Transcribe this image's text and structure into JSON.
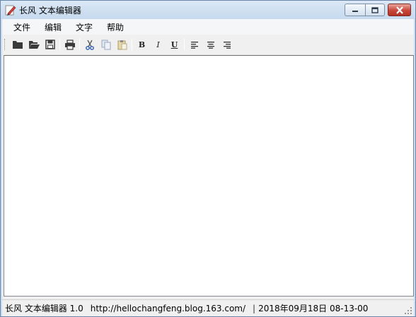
{
  "window": {
    "title": "长风 文本编辑器",
    "accent": "#c9dcf0",
    "close_color": "#c9463a"
  },
  "menu": {
    "items": [
      {
        "label": "文件"
      },
      {
        "label": "编辑"
      },
      {
        "label": "文字"
      },
      {
        "label": "帮助"
      }
    ]
  },
  "toolbar": {
    "icons": [
      "new-folder-icon",
      "open-folder-icon",
      "save-icon",
      "print-icon",
      "cut-icon",
      "copy-icon",
      "paste-icon",
      "bold-icon",
      "italic-icon",
      "underline-icon",
      "align-left-icon",
      "align-center-icon",
      "align-right-icon"
    ],
    "bold_label": "B",
    "italic_label": "I",
    "underline_label": "U"
  },
  "editor": {
    "value": ""
  },
  "status": {
    "app": "长风 文本编辑器 1.0",
    "url": "http://hellochangfeng.blog.163.com/",
    "sep": "|",
    "datetime": "2018年09月18日 08-13-00"
  }
}
